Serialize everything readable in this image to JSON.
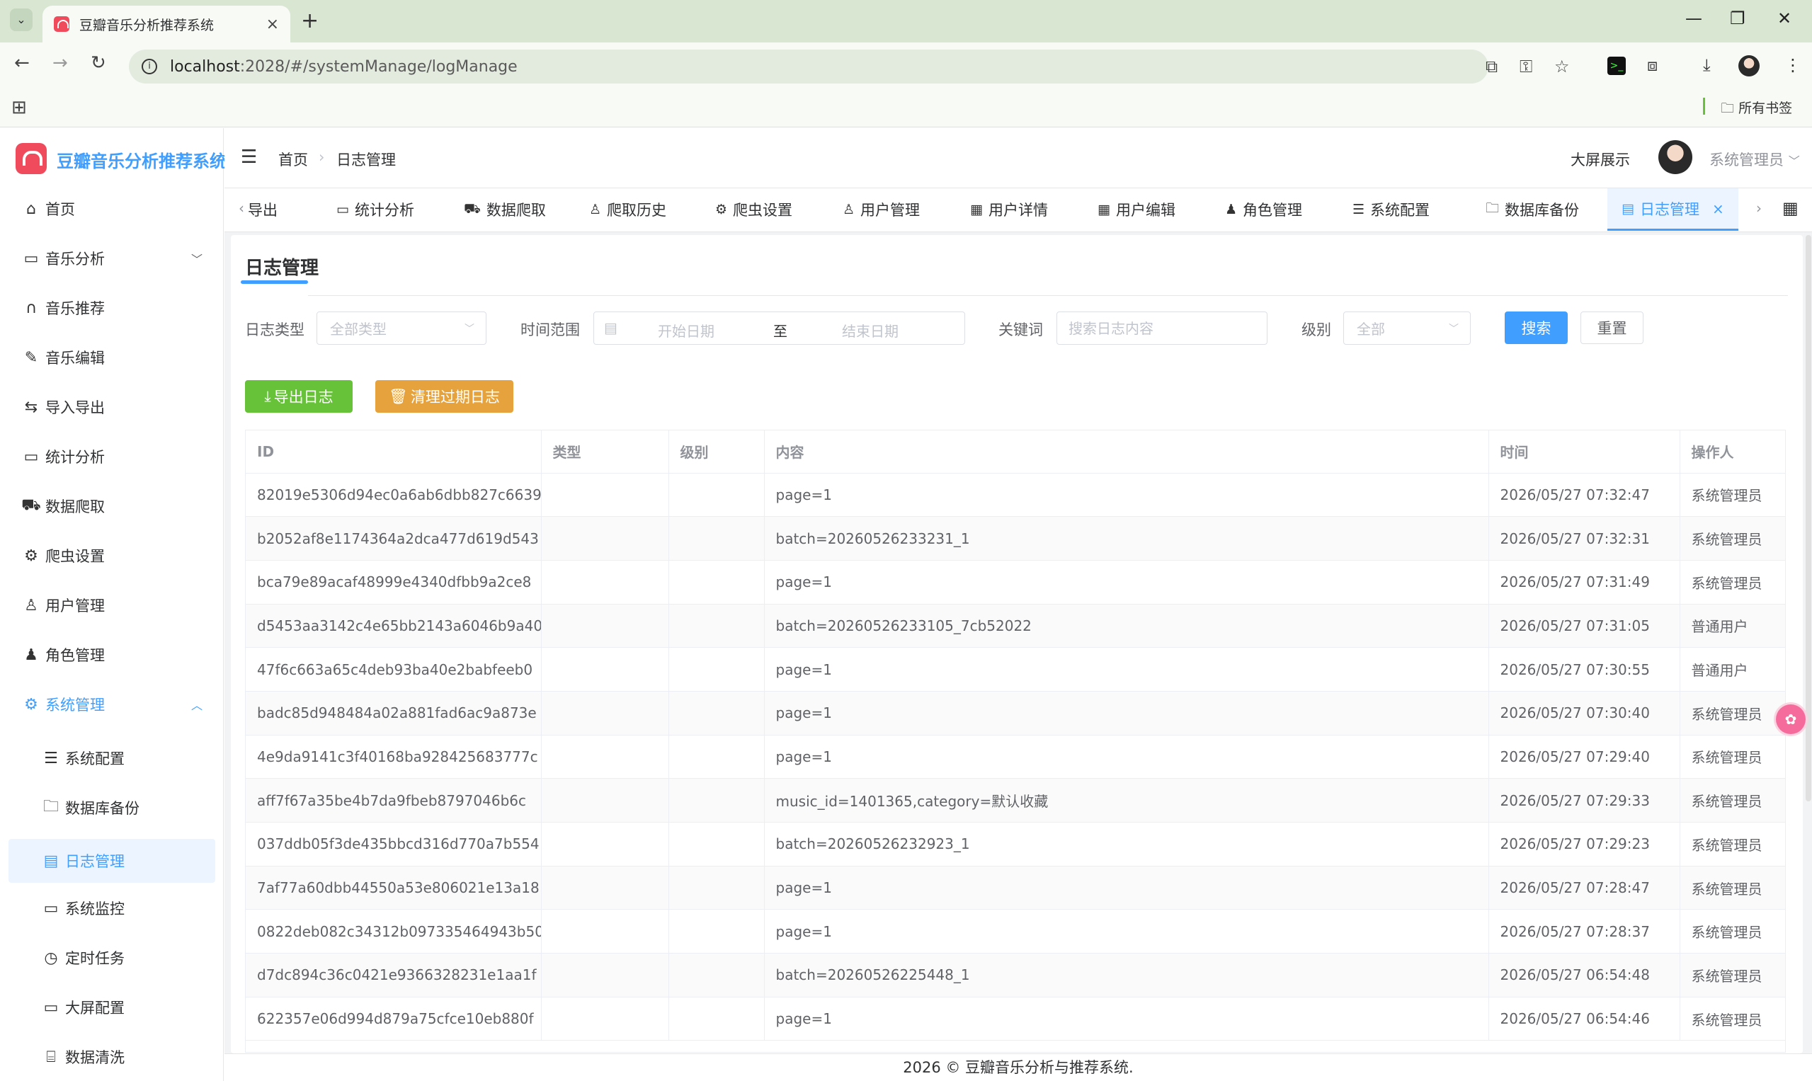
{
  "browser": {
    "tab_title": "豆瓣音乐分析推荐系统",
    "url_host": "localhost",
    "url_path": ":2028/#/systemManage/logManage",
    "bookmarks_label": "所有书签"
  },
  "app": {
    "title": "豆瓣音乐分析推荐系统",
    "accent": "#409eff",
    "brand": "#ef4b5c"
  },
  "sidebar": {
    "items": [
      {
        "label": "首页",
        "icon": "home-icon"
      },
      {
        "label": "音乐分析",
        "icon": "chart-icon"
      },
      {
        "label": "音乐推荐",
        "icon": "headphones-icon"
      },
      {
        "label": "音乐编辑",
        "icon": "edit-icon"
      },
      {
        "label": "导入导出",
        "icon": "transfer-icon"
      },
      {
        "label": "统计分析",
        "icon": "chart-icon"
      },
      {
        "label": "数据爬取",
        "icon": "crawl-icon"
      },
      {
        "label": "爬虫设置",
        "icon": "gear-icon"
      },
      {
        "label": "用户管理",
        "icon": "user-icon"
      },
      {
        "label": "角色管理",
        "icon": "role-icon"
      },
      {
        "label": "系统管理",
        "icon": "gear-icon"
      }
    ],
    "sub_items": [
      {
        "label": "系统配置",
        "icon": "sliders-icon"
      },
      {
        "label": "数据库备份",
        "icon": "folder-icon"
      },
      {
        "label": "日志管理",
        "icon": "document-icon"
      },
      {
        "label": "系统监控",
        "icon": "monitor-icon"
      },
      {
        "label": "定时任务",
        "icon": "timer-icon"
      },
      {
        "label": "大屏配置",
        "icon": "screen-icon"
      },
      {
        "label": "数据清洗",
        "icon": "clean-icon"
      }
    ]
  },
  "header": {
    "breadcrumb_home": "首页",
    "breadcrumb_current": "日志管理",
    "bigscreen": "大屏展示",
    "username": "系统管理员"
  },
  "tags": [
    {
      "label": "导出",
      "icon": ""
    },
    {
      "label": "统计分析",
      "icon": "chart-icon"
    },
    {
      "label": "数据爬取",
      "icon": "crawl-icon"
    },
    {
      "label": "爬取历史",
      "icon": "user-icon"
    },
    {
      "label": "爬虫设置",
      "icon": "gear-icon"
    },
    {
      "label": "用户管理",
      "icon": "user-icon"
    },
    {
      "label": "用户详情",
      "icon": "grid-icon"
    },
    {
      "label": "用户编辑",
      "icon": "grid-icon"
    },
    {
      "label": "角色管理",
      "icon": "role-icon"
    },
    {
      "label": "系统配置",
      "icon": "sliders-icon"
    },
    {
      "label": "数据库备份",
      "icon": "folder-icon"
    },
    {
      "label": "日志管理",
      "icon": "document-icon"
    }
  ],
  "page": {
    "title": "日志管理"
  },
  "filters": {
    "log_type_label": "日志类型",
    "log_type_value": "全部类型",
    "time_range_label": "时间范围",
    "start_placeholder": "开始日期",
    "range_separator": "至",
    "end_placeholder": "结束日期",
    "keyword_label": "关键词",
    "keyword_placeholder": "搜索日志内容",
    "level_label": "级别",
    "level_value": "全部",
    "search_button": "搜索",
    "reset_button": "重置"
  },
  "actions": {
    "export_button": "导出日志",
    "clean_button": "清理过期日志"
  },
  "table": {
    "columns": [
      "ID",
      "类型",
      "级别",
      "内容",
      "时间",
      "操作人"
    ],
    "rows": [
      [
        "82019e5306d94ec0a6ab6dbb827c6639",
        "",
        "",
        "page=1",
        "2026/05/27 07:32:47",
        "系统管理员"
      ],
      [
        "b2052af8e1174364a2dca477d619d543",
        "",
        "",
        "batch=20260526233231_1",
        "2026/05/27 07:32:31",
        "系统管理员"
      ],
      [
        "bca79e89acaf48999e4340dfbb9a2ce8",
        "",
        "",
        "page=1",
        "2026/05/27 07:31:49",
        "系统管理员"
      ],
      [
        "d5453aa3142c4e65bb2143a6046b9a40",
        "",
        "",
        "batch=20260526233105_7cb52022",
        "2026/05/27 07:31:05",
        "普通用户"
      ],
      [
        "47f6c663a65c4deb93ba40e2babfeeb0",
        "",
        "",
        "page=1",
        "2026/05/27 07:30:55",
        "普通用户"
      ],
      [
        "badc85d948484a02a881fad6ac9a873e",
        "",
        "",
        "page=1",
        "2026/05/27 07:30:40",
        "系统管理员"
      ],
      [
        "4e9da9141c3f40168ba928425683777c",
        "",
        "",
        "page=1",
        "2026/05/27 07:29:40",
        "系统管理员"
      ],
      [
        "aff7f67a35be4b7da9fbeb8797046b6c",
        "",
        "",
        "music_id=1401365,category=默认收藏",
        "2026/05/27 07:29:33",
        "系统管理员"
      ],
      [
        "037ddb05f3de435bbcd316d770a7b554",
        "",
        "",
        "batch=20260526232923_1",
        "2026/05/27 07:29:23",
        "系统管理员"
      ],
      [
        "7af77a60dbb44550a53e806021e13a18",
        "",
        "",
        "page=1",
        "2026/05/27 07:28:47",
        "系统管理员"
      ],
      [
        "0822deb082c34312b097335464943b50",
        "",
        "",
        "page=1",
        "2026/05/27 07:28:37",
        "系统管理员"
      ],
      [
        "d7dc894c36c0421e9366328231e1aa1f",
        "",
        "",
        "batch=20260526225448_1",
        "2026/05/27 06:54:48",
        "系统管理员"
      ],
      [
        "622357e06d994d879a75cfce10eb880f",
        "",
        "",
        "page=1",
        "2026/05/27 06:54:46",
        "系统管理员"
      ]
    ]
  },
  "footer": {
    "text": "2026 © 豆瓣音乐分析与推荐系统."
  }
}
